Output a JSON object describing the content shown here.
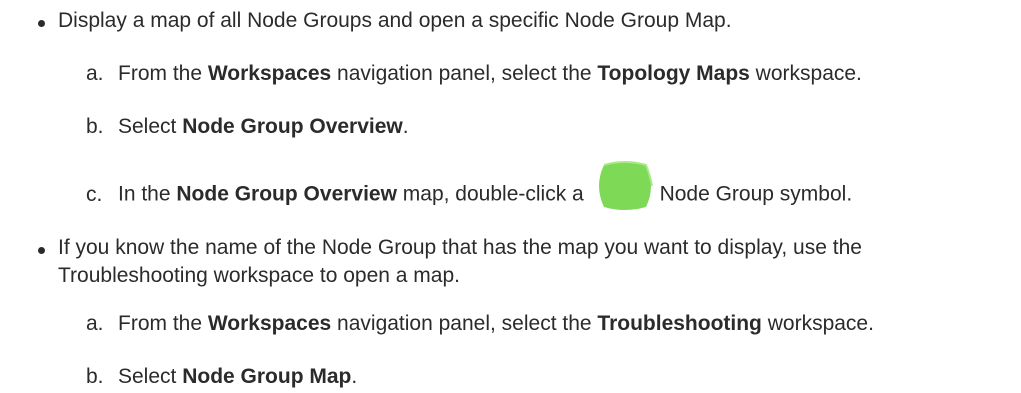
{
  "items": [
    {
      "text": "Display a map of all Node Groups and open a specific Node Group Map.",
      "steps": [
        {
          "marker": "a.",
          "pre": "From the ",
          "b1": "Workspaces",
          "mid": " navigation panel, select the ",
          "b2": "Topology Maps",
          "post": " workspace."
        },
        {
          "marker": "b.",
          "pre": "Select ",
          "b1": "Node Group Overview",
          "post": "."
        },
        {
          "marker": "c.",
          "pre": "In the ",
          "b1": "Node Group Overview",
          "mid": " map, double-click a",
          "icon": "node-group-symbol-icon",
          "icon_color": "#7ed957",
          "post": "Node Group symbol."
        }
      ]
    },
    {
      "text_line1": "If you know the name of the Node Group that has the map you want to display, use the",
      "text_line2": "Troubleshooting workspace to open a map.",
      "steps": [
        {
          "marker": "a.",
          "pre": "From the ",
          "b1": "Workspaces",
          "mid": " navigation panel, select the ",
          "b2": "Troubleshooting",
          "post": " workspace."
        },
        {
          "marker": "b.",
          "pre": "Select ",
          "b1": "Node Group Map",
          "post": "."
        }
      ]
    }
  ]
}
